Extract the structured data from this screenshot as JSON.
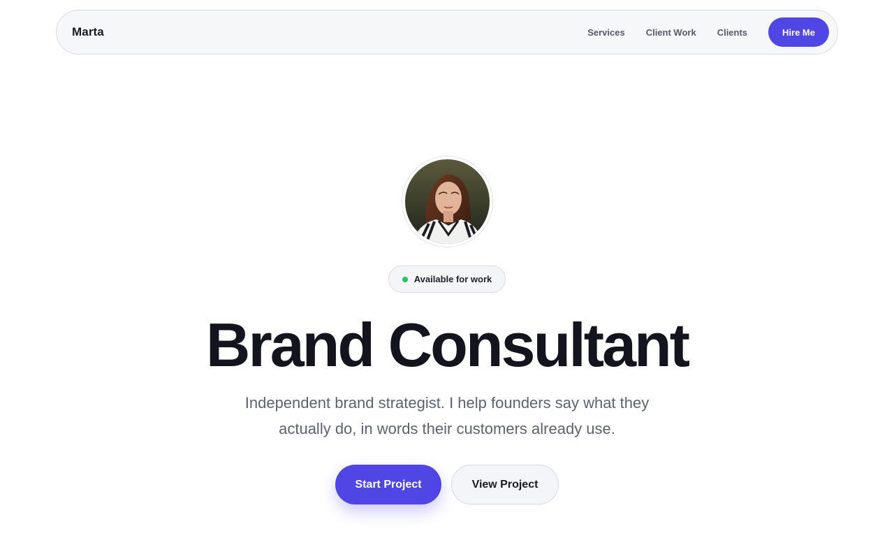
{
  "nav": {
    "brand": "Marta",
    "links": [
      "Services",
      "Client Work",
      "Clients"
    ],
    "cta_label": "Hire Me"
  },
  "hero": {
    "avatar_icon": "portrait-photo",
    "status_badge": "Available for work",
    "title": "Brand Consultant",
    "subtitle": "Independent brand strategist. I help founders say what they actually do, in words their customers already use.",
    "primary_cta": "Start Project",
    "secondary_cta": "View Project"
  },
  "colors": {
    "accent": "#4f46e5",
    "status_dot": "#22c55e",
    "heading": "#14141f",
    "body_text": "#5d6270"
  }
}
